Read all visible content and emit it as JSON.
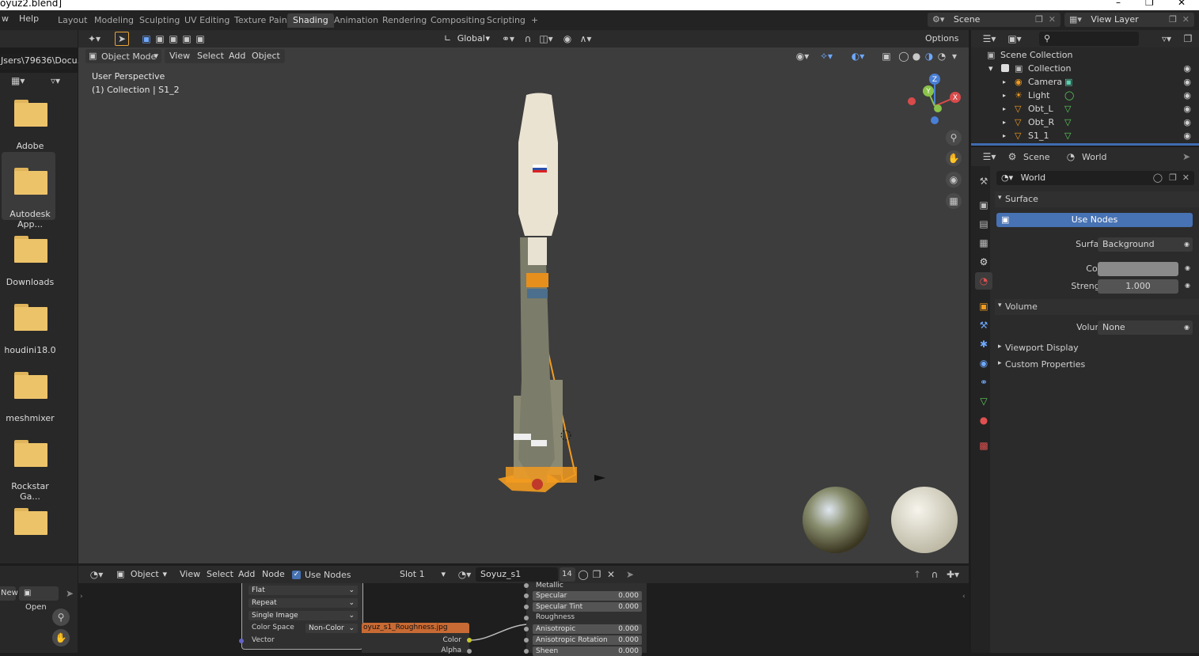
{
  "titlebar": {
    "title": "oyuz2.blend]",
    "minimize": "–",
    "maximize": "❐",
    "close": "✕"
  },
  "menu": {
    "file_partial": "w",
    "help": "Help"
  },
  "workspaces": [
    "Layout",
    "Modeling",
    "Sculpting",
    "UV Editing",
    "Texture Paint",
    "Shading",
    "Animation",
    "Rendering",
    "Compositing",
    "Scripting",
    "+"
  ],
  "active_workspace": "Shading",
  "scene": {
    "name": "Scene",
    "view_layer": "View Layer"
  },
  "filebrowser": {
    "path": "Jsers\\79636\\Docu...",
    "items": [
      "Adobe",
      "Autodesk App...",
      "Downloads",
      "houdini18.0",
      "meshmixer",
      "Rockstar Ga...",
      ""
    ],
    "new_label": "New",
    "open_label": "Open"
  },
  "viewport_header": {
    "orientation": "Global",
    "options": "Options"
  },
  "viewport_menu": {
    "mode": "Object Mode",
    "view": "View",
    "select": "Select",
    "add": "Add",
    "object": "Object"
  },
  "viewport_overlay": {
    "perspective": "User Perspective",
    "collection": "(1) Collection | S1_2"
  },
  "gizmo": {
    "z": "Z",
    "y": "Y",
    "x": "X"
  },
  "outliner": {
    "root": "Scene Collection",
    "collection": "Collection",
    "items": [
      "Camera",
      "Light",
      "Obt_L",
      "Obt_R",
      "S1_1"
    ]
  },
  "properties": {
    "breadcrumb_scene": "Scene",
    "breadcrumb_world": "World",
    "world_name": "World",
    "surface_panel": "Surface",
    "use_nodes": "Use Nodes",
    "surface_label": "Surface",
    "surface_value": "Background",
    "color_label": "Color",
    "color_value": "#8a8a8a",
    "strength_label": "Strength",
    "strength_value": "1.000",
    "volume_panel": "Volume",
    "volume_label": "Volume",
    "volume_value": "None",
    "viewport_display": "Viewport Display",
    "custom_properties": "Custom Properties"
  },
  "node_header": {
    "object": "Object",
    "view": "View",
    "select": "Select",
    "add": "Add",
    "node": "Node",
    "use_nodes": "Use Nodes",
    "slot": "Slot 1",
    "material": "Soyuz_s1",
    "users": "14"
  },
  "image_node": {
    "interpolation": "Flat",
    "extension": "Repeat",
    "source": "Single Image",
    "colorspace_label": "Color Space",
    "colorspace_value": "Non-Color",
    "vector": "Vector",
    "image_name": "oyuz_s1_Roughness.jpg",
    "out_color": "Color",
    "out_alpha": "Alpha"
  },
  "bsdf_node": {
    "metallic": "Metallic",
    "specular": "Specular",
    "specular_val": "0.000",
    "specular_tint": "Specular Tint",
    "specular_tint_val": "0.000",
    "roughness": "Roughness",
    "anisotropic": "Anisotropic",
    "anisotropic_val": "0.000",
    "anisotropic_rotation": "Anisotropic Rotation",
    "anisotropic_rotation_val": "0.000",
    "sheen": "Sheen",
    "sheen_val": "0.000"
  }
}
